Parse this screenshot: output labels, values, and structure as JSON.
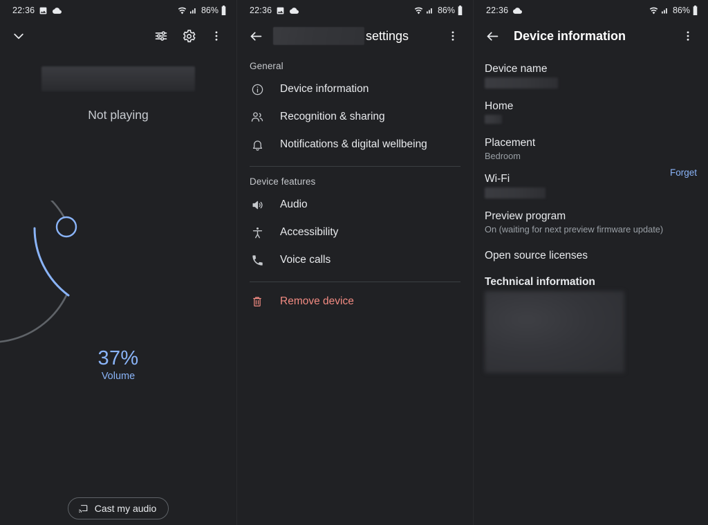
{
  "statusbar": {
    "time": "22:36",
    "battery": "86%",
    "icons": [
      "image-icon",
      "cloud-icon",
      "wifi-icon",
      "signal-icon",
      "battery-icon"
    ]
  },
  "panel1": {
    "name": "now-playing-panel",
    "appbar": {
      "collapse_icon": "chevron-down-icon",
      "equalizer_icon": "tune-sliders-icon",
      "settings_icon": "gear-icon",
      "overflow_icon": "more-vert-icon"
    },
    "album_art": "redacted-album-art",
    "status_text": "Not playing",
    "volume": {
      "percent_label": "37%",
      "percent_value": 37,
      "label": "Volume",
      "accent": "#8ab4f8",
      "track": "#5f6368"
    },
    "cast_button": {
      "label": "Cast my audio",
      "icon": "cast-icon"
    }
  },
  "panel2": {
    "name": "device-settings-panel",
    "appbar": {
      "back_icon": "arrow-back-icon",
      "title_redacted": "",
      "title_suffix": "settings",
      "overflow_icon": "more-vert-icon"
    },
    "sections": [
      {
        "header": "General",
        "items": [
          {
            "label": "Device information",
            "icon": "info-circle-icon"
          },
          {
            "label": "Recognition & sharing",
            "icon": "people-icon"
          },
          {
            "label": "Notifications & digital wellbeing",
            "icon": "bell-icon"
          }
        ]
      },
      {
        "header": "Device features",
        "items": [
          {
            "label": "Audio",
            "icon": "volume-up-icon"
          },
          {
            "label": "Accessibility",
            "icon": "accessibility-icon"
          },
          {
            "label": "Voice calls",
            "icon": "phone-icon"
          }
        ]
      }
    ],
    "remove": {
      "label": "Remove device",
      "icon": "trash-icon",
      "color": "#f28b82"
    }
  },
  "panel3": {
    "name": "device-information-panel",
    "appbar": {
      "back_icon": "arrow-back-icon",
      "title": "Device information",
      "overflow_icon": "more-vert-icon"
    },
    "items": [
      {
        "label": "Device name",
        "value": "",
        "redacted": true,
        "redact_w": 108,
        "redact_h": 15
      },
      {
        "label": "Home",
        "value": "",
        "redacted": true,
        "redact_w": 24,
        "redact_h": 13
      },
      {
        "label": "Placement",
        "value": "Bedroom",
        "redacted": false
      },
      {
        "label": "Wi-Fi",
        "value": "",
        "redacted": true,
        "redact_w": 90,
        "redact_h": 15,
        "action": "Forget"
      },
      {
        "label": "Preview program",
        "value": "On (waiting for next preview firmware update)",
        "redacted": false
      },
      {
        "label": "Open source licenses",
        "value": "",
        "redacted": false
      },
      {
        "label": "Technical information",
        "value": "",
        "redacted": false,
        "bold": true,
        "block": true
      }
    ]
  }
}
